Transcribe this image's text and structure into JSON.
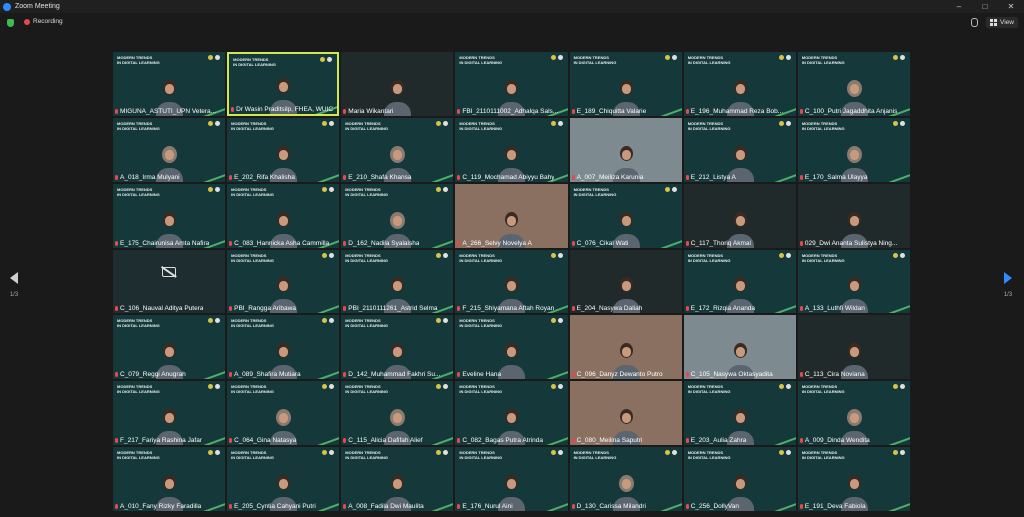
{
  "window": {
    "title": "Zoom Meeting"
  },
  "toolbar": {
    "recording_label": "Recording",
    "view_label": "View"
  },
  "pager": {
    "left": "1/3",
    "right": "1/3"
  },
  "slide": {
    "line1": "MODERN TRENDS",
    "line2": "IN DIGITAL LEARNING"
  },
  "tiles": [
    {
      "name": "MIGUNA_ASTUTI_UPN Vetera...",
      "type": "slide"
    },
    {
      "name": "Dr Wasin Praditsilp, FHEA, WUIC",
      "type": "video",
      "active": true
    },
    {
      "name": "Maria Wikantari",
      "type": "dark"
    },
    {
      "name": "FBI_2110111002_Adhalqa Sals...",
      "type": "slide"
    },
    {
      "name": "E_189_Chiquitta Valarie",
      "type": "slide"
    },
    {
      "name": "E_196_Muhammad Reza Bob...",
      "type": "slide"
    },
    {
      "name": "C_100_Putri Jagaddhita Anjanis",
      "type": "hijab"
    },
    {
      "name": "A_018_Irma Mulyani",
      "type": "hijab"
    },
    {
      "name": "E_202_Rifa Khalisha",
      "type": "slide"
    },
    {
      "name": "E_210_Shafa Khansa",
      "type": "hijab"
    },
    {
      "name": "C_119_Mochamad Abiyyu Bahy",
      "type": "slide"
    },
    {
      "name": "A_007_Meiliza Karunia",
      "type": "light"
    },
    {
      "name": "E_212_Listya A",
      "type": "slide"
    },
    {
      "name": "E_170_Salma Ulayya",
      "type": "hijab"
    },
    {
      "name": "E_175_Chairunisa Amta Nafira",
      "type": "slide"
    },
    {
      "name": "C_083_Hannicka Asha Cammilla",
      "type": "slide"
    },
    {
      "name": "D_162_Nadila Syalaisha",
      "type": "hijab"
    },
    {
      "name": "A_266_Selvy Novelya A",
      "type": "warm"
    },
    {
      "name": "C_076_Cikal Wati",
      "type": "slide"
    },
    {
      "name": "C_117_Thoriq Akmal",
      "type": "dark"
    },
    {
      "name": "029_Dwi Ananta Sulistya Ning...",
      "type": "dark"
    },
    {
      "name": "C_106_Nauval Aditya Putera",
      "type": "cam-off"
    },
    {
      "name": "PBI_Rangga Aribawa",
      "type": "slide"
    },
    {
      "name": "PBI_2110111261_Astrid Selma",
      "type": "slide"
    },
    {
      "name": "F_215_Shiyamana Aftah Royan",
      "type": "slide"
    },
    {
      "name": "E_204_Nasywa Daliah",
      "type": "dark"
    },
    {
      "name": "E_172_Rizqia Ananda",
      "type": "slide"
    },
    {
      "name": "A_133_Luthfi Wildan",
      "type": "slide"
    },
    {
      "name": "C_079_Reggi Anugrah",
      "type": "slide"
    },
    {
      "name": "A_089_Shafira Mutiara",
      "type": "slide"
    },
    {
      "name": "D_142_Muhammad Fakhri Su...",
      "type": "slide"
    },
    {
      "name": "Eveline Hana",
      "type": "slide"
    },
    {
      "name": "C_096_Danyz Dewanto Putro",
      "type": "warm"
    },
    {
      "name": "C_105_Nasywa Oktasyadita",
      "type": "light"
    },
    {
      "name": "C_113_Cira Noviana",
      "type": "dark"
    },
    {
      "name": "F_217_Fariya Rashina Jafar",
      "type": "slide"
    },
    {
      "name": "C_064_Gina Natasya",
      "type": "hijab"
    },
    {
      "name": "C_115_Alicia Dafifah Alief",
      "type": "hijab"
    },
    {
      "name": "C_082_Bagas Putra Atrinda",
      "type": "slide"
    },
    {
      "name": "C_080_Meilina Saputri",
      "type": "warm"
    },
    {
      "name": "E_203_Aulia Zahra",
      "type": "slide"
    },
    {
      "name": "A_009_Dinda Wendita",
      "type": "hijab"
    },
    {
      "name": "A_010_Fany Rizky Faradilla",
      "type": "slide"
    },
    {
      "name": "E_205_Cyntia Cahyani Putri",
      "type": "slide"
    },
    {
      "name": "A_008_Fadila Dwi Maulita",
      "type": "slide"
    },
    {
      "name": "E_176_Nurul Aini",
      "type": "slide"
    },
    {
      "name": "D_130_Carissa Milandri",
      "type": "hijab"
    },
    {
      "name": "C_256_DollyVan",
      "type": "slide"
    },
    {
      "name": "E_191_Deva Fabiola",
      "type": "slide"
    }
  ]
}
